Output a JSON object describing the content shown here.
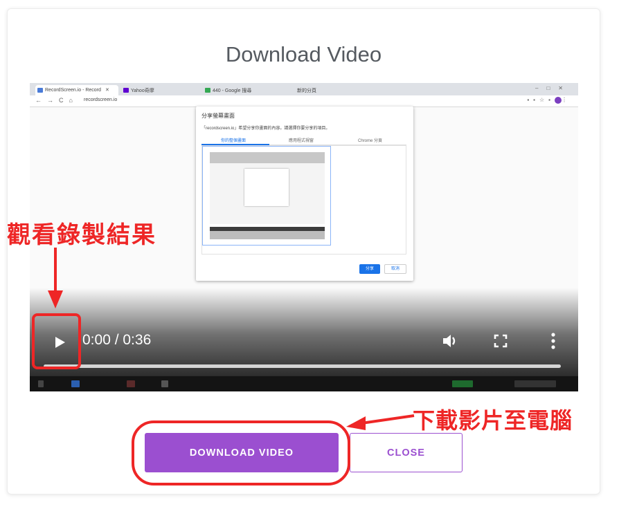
{
  "dialog": {
    "title": "Download Video",
    "download_label": "DOWNLOAD VIDEO",
    "close_label": "CLOSE"
  },
  "player": {
    "time_display": "0:00 / 0:36",
    "progress": 0
  },
  "recording": {
    "tabs": [
      {
        "label": "RecordScreen.io - Record",
        "active": true
      },
      {
        "label": "Yahoo奇摩",
        "active": false
      },
      {
        "label": "440 - Google 搜尋",
        "active": false
      },
      {
        "label": "新的分頁",
        "active": false
      }
    ],
    "url": "recordscreen.io",
    "share_dialog": {
      "title": "分享螢幕畫面",
      "description": "「recordscreen.io」希望分享你畫面的內容。請選擇你要分享的項目。",
      "tabs": [
        "你的整個畫面",
        "應用程式視窗",
        "Chrome 分頁"
      ],
      "share_label": "分享",
      "cancel_label": "取消"
    }
  },
  "annotations": {
    "left": "觀看錄製結果",
    "right": "下載影片至電腦",
    "color": "#ee2626"
  },
  "colors": {
    "accent": "#9b4fd0",
    "title": "#555a60"
  }
}
